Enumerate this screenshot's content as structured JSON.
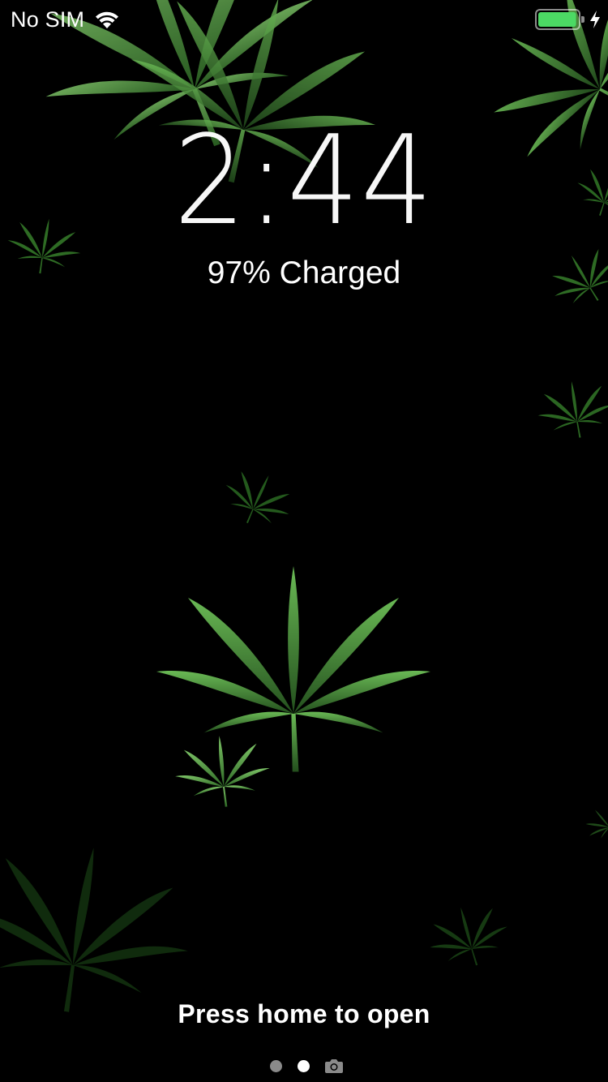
{
  "status_bar": {
    "carrier": "No SIM",
    "wifi_icon": "wifi-icon",
    "battery_icon": "battery-icon",
    "charging_icon": "bolt-icon",
    "battery_level": 0.97,
    "battery_color": "#4cd964"
  },
  "lock_screen": {
    "time": "2:44",
    "charge_status": "97% Charged",
    "unlock_prompt": "Press home to open"
  },
  "pager": {
    "page_count": 2,
    "active_index": 1,
    "camera_icon": "camera-icon"
  },
  "wallpaper": {
    "theme": "green leaves on black",
    "leaf_colors": [
      "#5fae4a",
      "#3e8a2f",
      "#1f4f1a",
      "#0f2a0d"
    ]
  }
}
